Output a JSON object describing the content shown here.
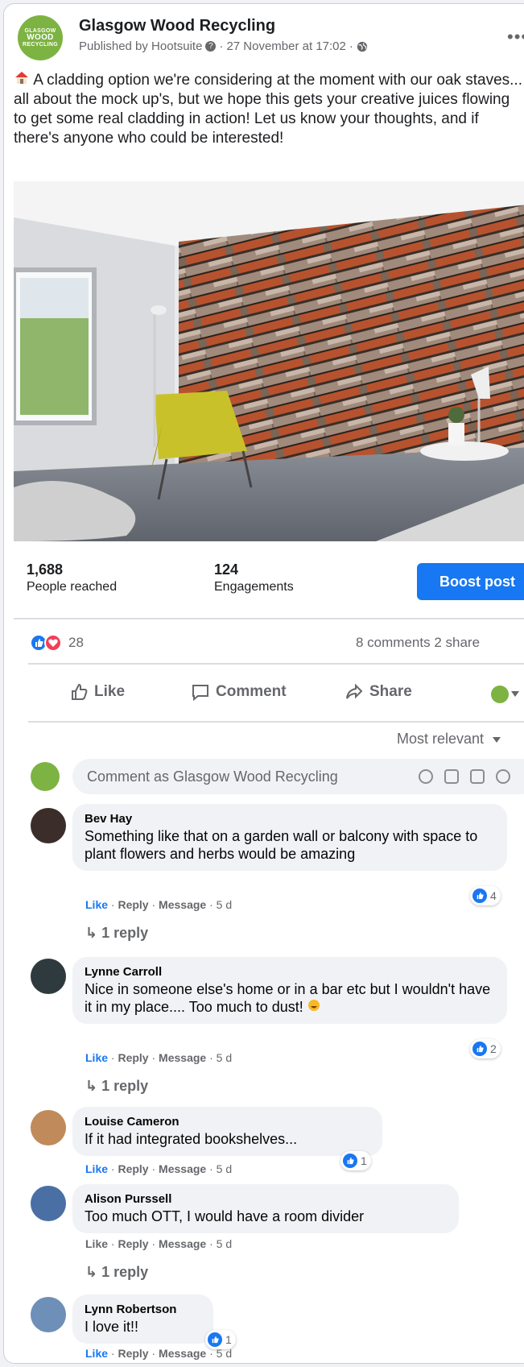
{
  "post": {
    "page_name": "Glasgow Wood Recycling",
    "avatar_text": [
      "GLASGOW",
      "WOOD",
      "RECYCLING"
    ],
    "published_by": "Published by Hootsuite",
    "timestamp": "27 November at 17:02",
    "text": "A cladding option we're considering at the moment with our oak staves... all about the mock up's, but we hope this gets your creative juices flowing to get some real cladding in action! Let us know your thoughts, and if there's anyone who could be interested!"
  },
  "stats": {
    "people_reached": "1,688",
    "people_reached_label": "People reached",
    "engagements": "124",
    "engagements_label": "Engagements",
    "boost_label": "Boost post"
  },
  "reactions": {
    "count": "28",
    "comments": "8 comments",
    "shares": "2 share"
  },
  "actions": {
    "like": "Like",
    "comment": "Comment",
    "share": "Share"
  },
  "sort_label": "Most relevant",
  "composer_placeholder": "Comment as Glasgow Wood Recycling",
  "comment_meta": {
    "like": "Like",
    "reply": "Reply",
    "message": "Message",
    "sep": "·"
  },
  "comments": [
    {
      "author": "Bev Hay",
      "text": "Something like that on a garden wall or balcony with space to plant flowers and herbs would be amazing",
      "age": "5 d",
      "likes": "4",
      "replies": "1 reply",
      "liked": true
    },
    {
      "author": "Lynne Carroll",
      "text": "Nice in someone else's home or in a bar etc but I wouldn't have it in my place.... Too much to dust!",
      "age": "5 d",
      "likes": "2",
      "replies": "1 reply",
      "liked": true
    },
    {
      "author": "Louise Cameron",
      "text": "If it had integrated bookshelves...",
      "age": "5 d",
      "likes": "1",
      "replies": "",
      "liked": true
    },
    {
      "author": "Alison Purssell",
      "text": "Too much OTT, I would have a room divider",
      "age": "5 d",
      "likes": "",
      "replies": "1 reply",
      "liked": false
    },
    {
      "author": "Lynn Robertson",
      "text": "I love it!!",
      "age": "5 d",
      "likes": "1",
      "replies": "",
      "liked": true
    }
  ],
  "colors": {
    "accent": "#1877f2",
    "brand_green": "#7cb342",
    "love": "#f33e58"
  }
}
